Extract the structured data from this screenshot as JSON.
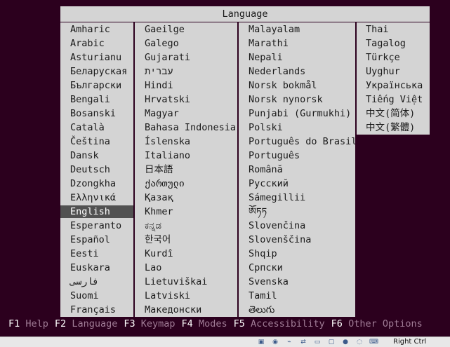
{
  "dialog": {
    "title": "Language",
    "columns": [
      [
        "Amharic",
        "Arabic",
        "Asturianu",
        "Беларуская",
        "Български",
        "Bengali",
        "Bosanski",
        "Català",
        "Čeština",
        "Dansk",
        "Deutsch",
        "Dzongkha",
        "Ελληνικά",
        "English",
        "Esperanto",
        "Español",
        "Eesti",
        "Euskara",
        "فارسی",
        "Suomi",
        "Français"
      ],
      [
        "Gaeilge",
        "Galego",
        "Gujarati",
        "עברית",
        "Hindi",
        "Hrvatski",
        "Magyar",
        "Bahasa Indonesia",
        "Íslenska",
        "Italiano",
        "日本語",
        "ქართული",
        "Қазақ",
        "Khmer",
        "ಕನ್ನಡ",
        "한국어",
        "Kurdî",
        "Lao",
        "Lietuviškai",
        "Latviski",
        "Македонски"
      ],
      [
        "Malayalam",
        "Marathi",
        "Nepali",
        "Nederlands",
        "Norsk bokmål",
        "Norsk nynorsk",
        "Punjabi (Gurmukhi)",
        "Polski",
        "Português do Brasil",
        "Português",
        "Română",
        "Русский",
        "Sámegillii",
        "ༀཏཏ",
        "Slovenčina",
        "Slovenščina",
        "Shqip",
        "Српски",
        "Svenska",
        "Tamil",
        "తెలుగు"
      ],
      [
        "Thai",
        "Tagalog",
        "Türkçe",
        "Uyghur",
        "Українська",
        "Tiếng Việt",
        "中文(简体)",
        "中文(繁體)"
      ]
    ],
    "selected": "English"
  },
  "function_keys": [
    {
      "key": "F1",
      "label": "Help"
    },
    {
      "key": "F2",
      "label": "Language"
    },
    {
      "key": "F3",
      "label": "Keymap"
    },
    {
      "key": "F4",
      "label": "Modes"
    },
    {
      "key": "F5",
      "label": "Accessibility"
    },
    {
      "key": "F6",
      "label": "Other Options"
    }
  ],
  "statusbar": {
    "host_key": "Right Ctrl",
    "icons": [
      "hard-disk-icon",
      "cd-icon",
      "usb-icon",
      "network-icon",
      "shared-folder-icon",
      "display-icon",
      "video-capture-icon",
      "mouse-integration-icon",
      "keyboard-capture-icon"
    ]
  },
  "colors": {
    "background": "#2c001e",
    "panel": "#d4d4d4",
    "selection": "#515151",
    "fkey_label": "#a07c96"
  }
}
